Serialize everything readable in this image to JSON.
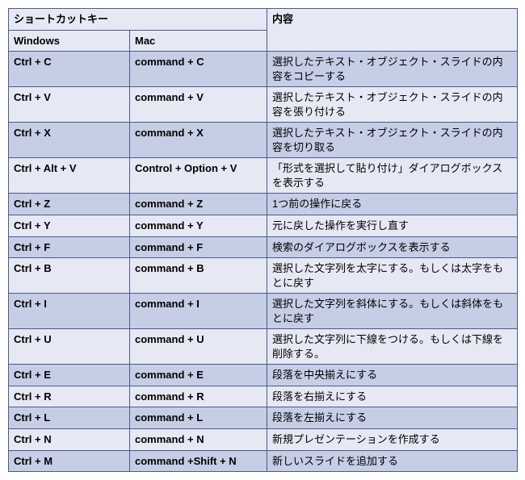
{
  "headers": {
    "shortcut": "ショートカットキー",
    "content": "内容",
    "windows": "Windows",
    "mac": "Mac"
  },
  "rows": [
    {
      "win": "Ctrl + C",
      "mac": "command + C",
      "desc": "選択したテキスト・オブジェクト・スライドの内容をコピーする"
    },
    {
      "win": "Ctrl + V",
      "mac": "command + V",
      "desc": "選択したテキスト・オブジェクト・スライドの内容を張り付ける"
    },
    {
      "win": "Ctrl + X",
      "mac": "command + X",
      "desc": "選択したテキスト・オブジェクト・スライドの内容を切り取る"
    },
    {
      "win": "Ctrl + Alt + V",
      "mac": "Control + Option + V",
      "desc": "「形式を選択して貼り付け」ダイアログボックスを表示する"
    },
    {
      "win": "Ctrl + Z",
      "mac": "command + Z",
      "desc": "1つ前の操作に戻る"
    },
    {
      "win": "Ctrl + Y",
      "mac": "command + Y",
      "desc": "元に戻した操作を実行し直す"
    },
    {
      "win": "Ctrl + F",
      "mac": "command + F",
      "desc": "検索のダイアログボックスを表示する"
    },
    {
      "win": "Ctrl + B",
      "mac": "command + B",
      "desc": "選択した文字列を太字にする。もしくは太字をもとに戻す"
    },
    {
      "win": "Ctrl + I",
      "mac": "command + I",
      "desc": "選択した文字列を斜体にする。もしくは斜体をもとに戻す"
    },
    {
      "win": "Ctrl + U",
      "mac": "command + U",
      "desc": "選択した文字列に下線をつける。もしくは下線を削除する。"
    },
    {
      "win": "Ctrl + E",
      "mac": "command + E",
      "desc": "段落を中央揃えにする"
    },
    {
      "win": "Ctrl + R",
      "mac": "command + R",
      "desc": "段落を右揃えにする"
    },
    {
      "win": "Ctrl + L",
      "mac": "command + L",
      "desc": "段落を左揃えにする"
    },
    {
      "win": "Ctrl + N",
      "mac": "command + N",
      "desc": "新規プレゼンテーションを作成する"
    },
    {
      "win": "Ctrl + M",
      "mac": "command +Shift + N",
      "desc": "新しいスライドを追加する"
    }
  ]
}
